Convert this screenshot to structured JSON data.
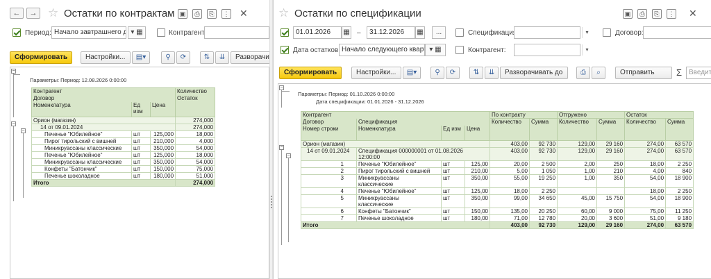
{
  "left": {
    "title": "Остатки по контрактам",
    "period_label": "Период:",
    "period_value": "Начало завтрашнего дн",
    "counterparty_label": "Контрагент:",
    "generate_label": "Сформировать",
    "settings_label": "Настройки...",
    "expand_label": "Разворачив",
    "params": "Параметры: Период: 12.08.2026 0:00:00",
    "headers": {
      "counterparty": "Контрагент",
      "contract": "Договор",
      "item": "Номенклатура",
      "unit": "Ед изм",
      "price": "Цена",
      "qty1": "Количество",
      "qty2": "Остаток"
    },
    "group": {
      "name": "Орион (магазин)",
      "qty": "274,000"
    },
    "subgroup": {
      "name": "14 от 09.01.2024",
      "qty": "274,000"
    },
    "rows": [
      {
        "item": "Печенье \"Юбилейное\"",
        "unit": "шт",
        "price": "125,000",
        "qty": "18,000"
      },
      {
        "item": "Пирог тирольский с вишней",
        "unit": "шт",
        "price": "210,000",
        "qty": "4,000"
      },
      {
        "item": "Миникруассаны классические",
        "unit": "шт",
        "price": "350,000",
        "qty": "54,000"
      },
      {
        "item": "Печенье \"Юбилейное\"",
        "unit": "шт",
        "price": "125,000",
        "qty": "18,000"
      },
      {
        "item": "Миникруассаны классические",
        "unit": "шт",
        "price": "350,000",
        "qty": "54,000"
      },
      {
        "item": "Конфеты \"Батончик\"",
        "unit": "шт",
        "price": "150,000",
        "qty": "75,000"
      },
      {
        "item": "Печенье шоколадное",
        "unit": "шт",
        "price": "180,000",
        "qty": "51,000"
      }
    ],
    "total": {
      "label": "Итого",
      "qty": "274,000"
    }
  },
  "right": {
    "title": "Остатки по спецификации",
    "date_from": "01.01.2026",
    "dash": "–",
    "date_to": "31.12.2026",
    "dots_label": "...",
    "spec_label": "Спецификация:",
    "contract_label": "Договор:",
    "balance_date_label": "Дата остатков:",
    "balance_date_value": "Начало следующего кварта",
    "counterparty_label": "Контрагент:",
    "generate_label": "Сформировать",
    "settings_label": "Настройки...",
    "expand_label": "Разворачивать до",
    "send_label": "Отправить",
    "sigma": "Σ",
    "search_placeholder": "Введите",
    "params1": "Параметры: Период: 01.10.2026 0:00:00",
    "params2": "Дата спецификации: 01.01.2026 - 31.12.2026",
    "headers": {
      "counterparty": "Контрагент",
      "contract": "Договор",
      "line": "Номер строки",
      "spec": "Спецификация",
      "item": "Номенклатура",
      "unit": "Ед изм",
      "price": "Цена",
      "by_contract": "По контракту",
      "shipped": "Отгружено",
      "balance": "Остаток",
      "qty": "Количество",
      "sum": "Сумма"
    },
    "group": {
      "name": "Орион (магазин)",
      "c_qty": "403,00",
      "c_sum": "92 730",
      "s_qty": "129,00",
      "s_sum": "29 160",
      "b_qty": "274,00",
      "b_sum": "63 570"
    },
    "subgroup": {
      "name": "14 от 09.01.2024",
      "spec": "Спецификация 000000001 от 01.08.2026",
      "spec2": "12:00:00",
      "c_qty": "403,00",
      "c_sum": "92 730",
      "s_qty": "129,00",
      "s_sum": "29 160",
      "b_qty": "274,00",
      "b_sum": "63 570"
    },
    "rows": [
      {
        "n": "1",
        "item": "Печенье \"Юбилейное\"",
        "item2": "",
        "unit": "шт",
        "price": "125,00",
        "c_qty": "20,00",
        "c_sum": "2 500",
        "s_qty": "2,00",
        "s_sum": "250",
        "b_qty": "18,00",
        "b_sum": "2 250"
      },
      {
        "n": "2",
        "item": "Пирог тирольский с вишней",
        "item2": "",
        "unit": "шт",
        "price": "210,00",
        "c_qty": "5,00",
        "c_sum": "1 050",
        "s_qty": "1,00",
        "s_sum": "210",
        "b_qty": "4,00",
        "b_sum": "840"
      },
      {
        "n": "3",
        "item": "Миникруассаны",
        "item2": "классические",
        "unit": "шт",
        "price": "350,00",
        "c_qty": "55,00",
        "c_sum": "19 250",
        "s_qty": "1,00",
        "s_sum": "350",
        "b_qty": "54,00",
        "b_sum": "18 900"
      },
      {
        "n": "4",
        "item": "Печенье \"Юбилейное\"",
        "item2": "",
        "unit": "шт",
        "price": "125,00",
        "c_qty": "18,00",
        "c_sum": "2 250",
        "s_qty": "",
        "s_sum": "",
        "b_qty": "18,00",
        "b_sum": "2 250"
      },
      {
        "n": "5",
        "item": "Миникруассаны",
        "item2": "классические",
        "unit": "шт",
        "price": "350,00",
        "c_qty": "99,00",
        "c_sum": "34 650",
        "s_qty": "45,00",
        "s_sum": "15 750",
        "b_qty": "54,00",
        "b_sum": "18 900"
      },
      {
        "n": "6",
        "item": "Конфеты \"Батончик\"",
        "item2": "",
        "unit": "шт",
        "price": "150,00",
        "c_qty": "135,00",
        "c_sum": "20 250",
        "s_qty": "60,00",
        "s_sum": "9 000",
        "b_qty": "75,00",
        "b_sum": "11 250"
      },
      {
        "n": "7",
        "item": "Печенье шоколадное",
        "item2": "",
        "unit": "шт",
        "price": "180,00",
        "c_qty": "71,00",
        "c_sum": "12 780",
        "s_qty": "20,00",
        "s_sum": "3 600",
        "b_qty": "51,00",
        "b_sum": "9 180"
      }
    ],
    "total": {
      "label": "Итого",
      "c_qty": "403,00",
      "c_sum": "92 730",
      "s_qty": "129,00",
      "s_sum": "29 160",
      "b_qty": "274,00",
      "b_sum": "63 570"
    }
  }
}
